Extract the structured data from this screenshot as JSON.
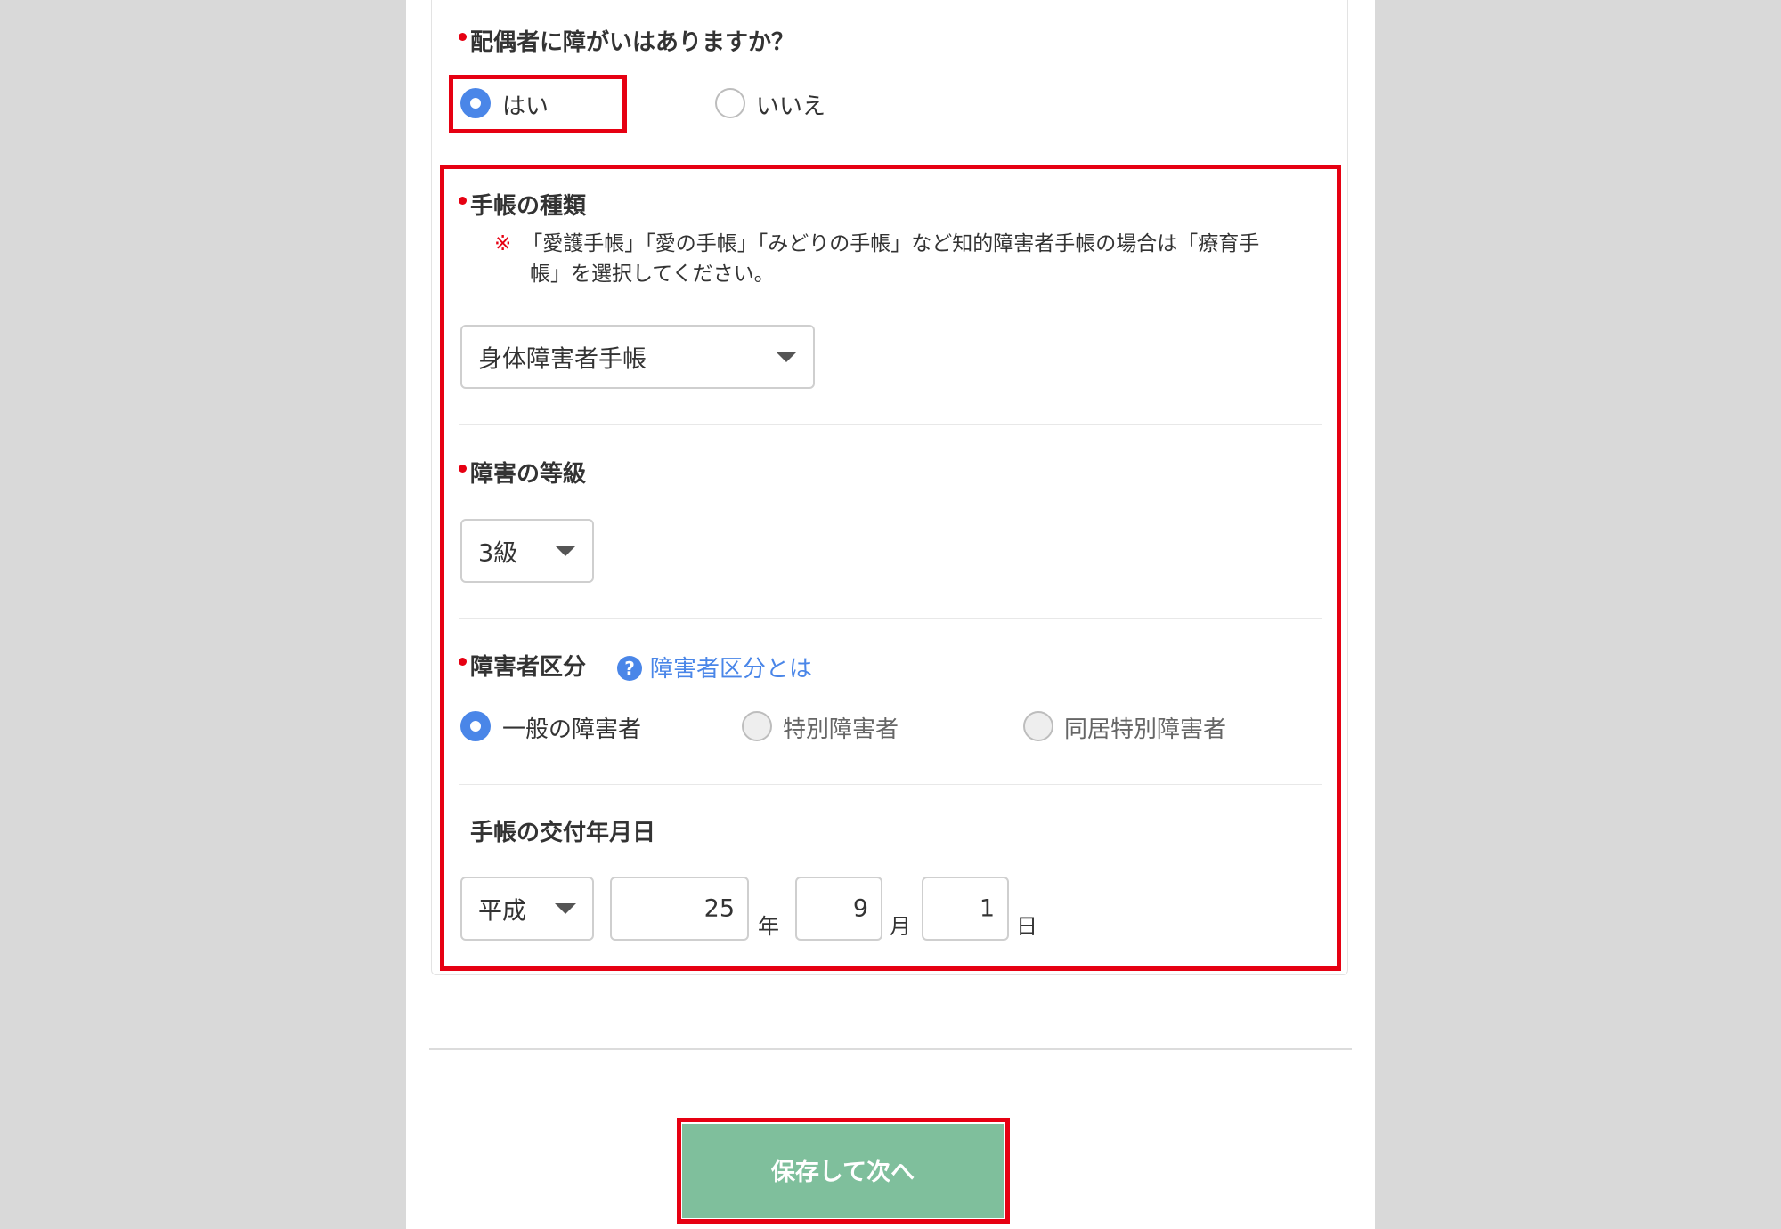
{
  "q_disability": {
    "label": "配偶者に障がいはありますか？",
    "options": [
      "はい",
      "いいえ"
    ],
    "selected": "はい"
  },
  "techo_type": {
    "label": "手帳の種類",
    "note_mark": "※",
    "note_line1": "「愛護手帳」「愛の手帳」「みどりの手帳」など知的障害者手帳の場合は「療育手",
    "note_line2": "帳」を選択してください。",
    "value": "身体障害者手帳"
  },
  "grade": {
    "label": "障害の等級",
    "value": "3級"
  },
  "category": {
    "label": "障害者区分",
    "help_icon": "?",
    "help_link": "障害者区分とは",
    "options": [
      "一般の障害者",
      "特別障害者",
      "同居特別障害者"
    ],
    "selected": "一般の障害者"
  },
  "issue_date": {
    "label": "手帳の交付年月日",
    "era": "平成",
    "year": "25",
    "year_unit": "年",
    "month": "9",
    "month_unit": "月",
    "day": "1",
    "day_unit": "日"
  },
  "save_button": "保存して次へ",
  "colors": {
    "accent": "#4a86e8",
    "required": "#e60012",
    "button": "#7fbf9c",
    "highlight": "#e60012"
  }
}
